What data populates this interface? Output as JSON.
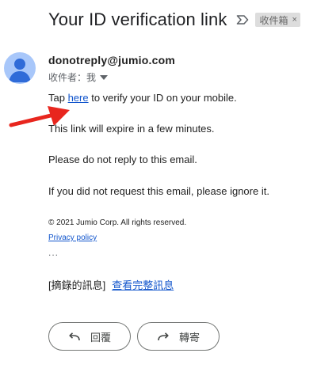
{
  "email": {
    "subject": "Your ID verification link",
    "label_chip": "收件箱",
    "label_chip_close": "×",
    "sender": "donotreply@jumio.com",
    "recipient": "收件者：我"
  },
  "body": {
    "p1_prefix": "Tap ",
    "p1_link": "here",
    "p1_suffix": " to verify your ID on your mobile.",
    "p2": "This link will expire in a few minutes.",
    "p3": "Please do not reply to this email.",
    "p4": "If you did not request this email, please ignore it.",
    "copyright": "© 2021 Jumio Corp. All rights reserved.",
    "privacy_link": "Privacy policy",
    "ellipsis": "...",
    "clipped_label": "[摘錄的訊息]",
    "view_full_link": "查看完整訊息"
  },
  "actions": {
    "reply_label": "回覆",
    "forward_label": "轉寄"
  },
  "colors": {
    "link": "#1155cc",
    "arrow": "#e8261e",
    "avatar": "#a8c7fa",
    "avatar_figure": "#2f6bd8"
  },
  "icons": {
    "important": "important-marker-icon",
    "avatar": "person-icon",
    "dropdown": "chevron-down-icon",
    "reply": "reply-icon",
    "forward": "forward-icon"
  }
}
